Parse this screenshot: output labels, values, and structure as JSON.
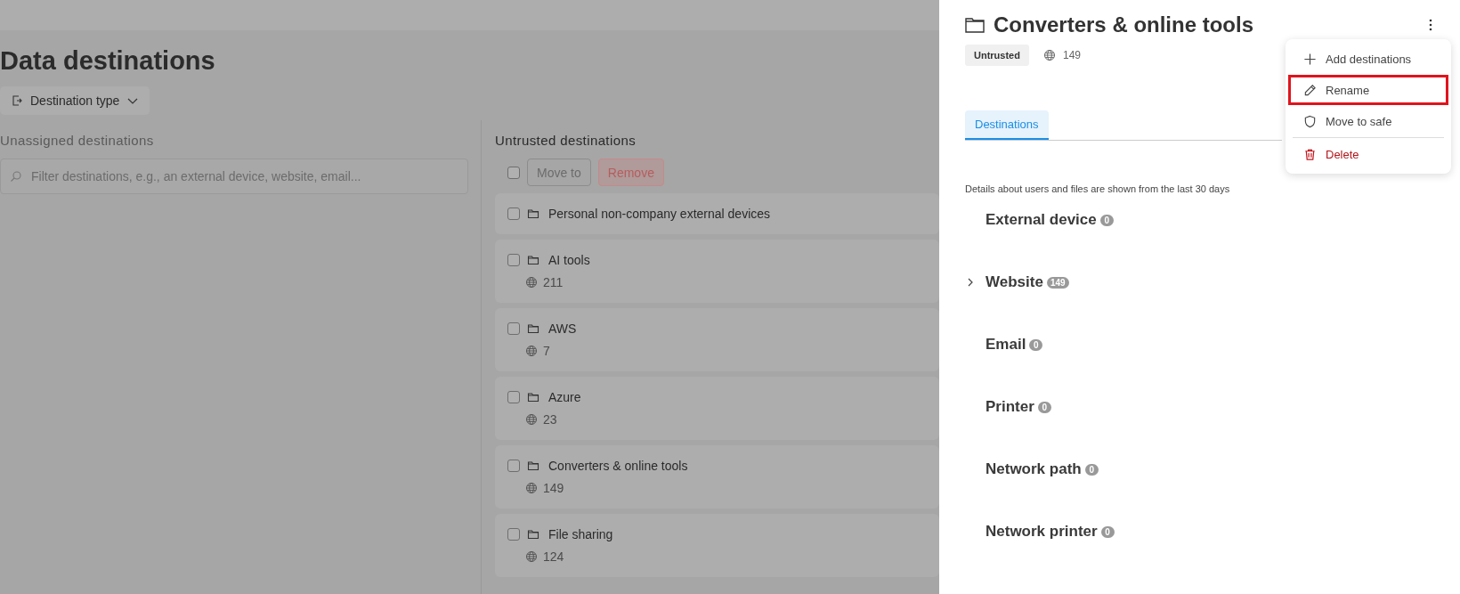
{
  "page": {
    "title": "Data destinations",
    "filter_button": "Destination type"
  },
  "unassigned": {
    "title": "Unassigned destinations",
    "search": {
      "placeholder": "Filter destinations, e.g., an external device, website, email..."
    }
  },
  "untrusted": {
    "title": "Untrusted destinations",
    "select_all": {
      "checked": false
    },
    "actions": [
      {
        "label": "Move to",
        "kind": "neutral"
      },
      {
        "label": "Remove",
        "kind": "danger"
      }
    ],
    "groups": [
      {
        "name": "Personal non-company external devices",
        "checked": false
      },
      {
        "name": "AI tools",
        "count": "211",
        "checked": false
      },
      {
        "name": "AWS",
        "count": "7",
        "checked": false
      },
      {
        "name": "Azure",
        "count": "23",
        "checked": false
      },
      {
        "name": "Converters & online tools",
        "count": "149",
        "checked": false
      },
      {
        "name": "File sharing",
        "count": "124",
        "checked": false
      }
    ]
  },
  "drawer": {
    "title": "Converters & online tools",
    "status": "Untrusted",
    "count": "149",
    "tabs": [
      {
        "label": "Destinations",
        "selected": true
      }
    ],
    "note": "Details about users and files are shown from the last 30 days",
    "categories": [
      {
        "name": "External device",
        "count": "0"
      },
      {
        "name": "Website",
        "count": "149",
        "expanded": false
      },
      {
        "name": "Email",
        "count": "0"
      },
      {
        "name": "Printer",
        "count": "0"
      },
      {
        "name": "Network path",
        "count": "0"
      },
      {
        "name": "Network printer",
        "count": "0"
      }
    ]
  },
  "menu": {
    "items": [
      {
        "label": "Add destinations",
        "kind": "plus",
        "danger": false,
        "highlighted": false
      },
      {
        "label": "Rename",
        "kind": "pencil",
        "danger": false,
        "highlighted": true
      },
      {
        "label": "Move to safe",
        "kind": "shield",
        "danger": false,
        "highlighted": false
      },
      {
        "label": "Delete",
        "kind": "trash",
        "danger": true,
        "highlighted": false
      }
    ]
  }
}
